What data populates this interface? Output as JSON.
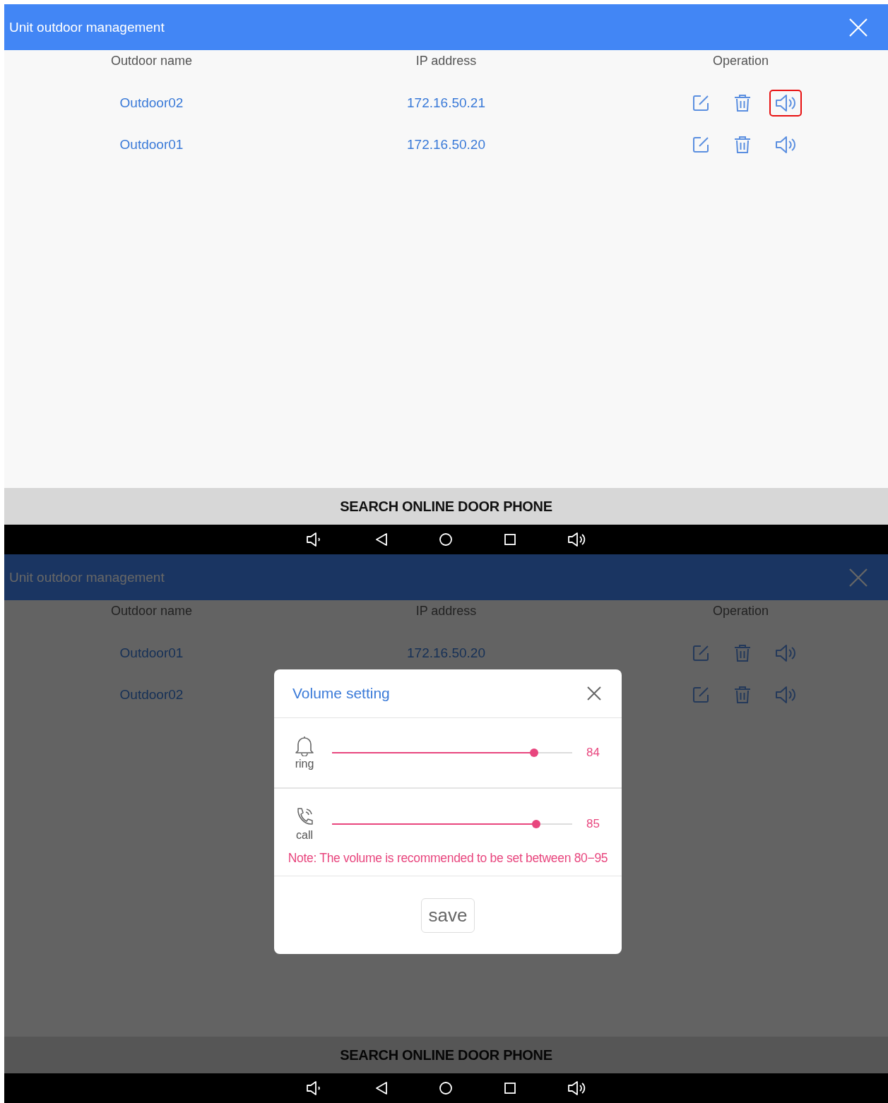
{
  "screens": [
    {
      "dimmed": false,
      "header": {
        "title": "Unit outdoor management"
      },
      "table": {
        "columns": [
          "Outdoor name",
          "IP address",
          "Operation"
        ],
        "rows": [
          {
            "name": "Outdoor02",
            "ip": "172.16.50.21",
            "highlighted": true
          },
          {
            "name": "Outdoor01",
            "ip": "172.16.50.20",
            "highlighted": false
          }
        ]
      },
      "search_button": "SEARCH ONLINE DOOR PHONE"
    },
    {
      "dimmed": true,
      "header": {
        "title": "Unit outdoor management"
      },
      "table": {
        "columns": [
          "Outdoor name",
          "IP address",
          "Operation"
        ],
        "rows": [
          {
            "name": "Outdoor01",
            "ip": "172.16.50.20",
            "highlighted": false
          },
          {
            "name": "Outdoor02",
            "highlighted": false
          }
        ]
      },
      "search_button": "SEARCH ONLINE DOOR PHONE",
      "dialog": {
        "title": "Volume setting",
        "channels": [
          {
            "kind": "ring",
            "label": "ring",
            "level": 0.84,
            "reading": "84"
          },
          {
            "kind": "call",
            "label": "call",
            "level": 0.85,
            "reading": "85"
          }
        ],
        "note": "Note: The volume is recommended to be set between 80−95",
        "save_button": "save"
      }
    }
  ]
}
